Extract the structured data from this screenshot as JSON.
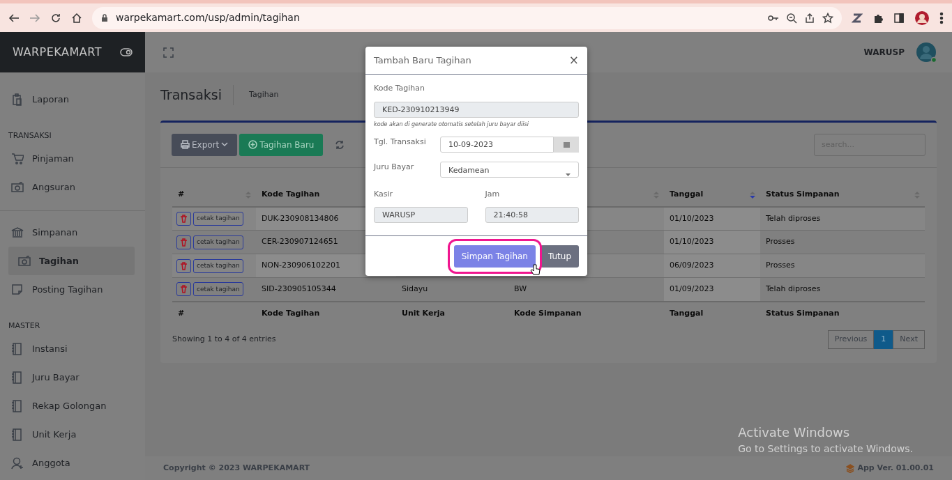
{
  "browser": {
    "url": "warpekamart.com/usp/admin/tagihan"
  },
  "brand": "WARPEKAMART",
  "user": {
    "name": "WARUSP",
    "online": true
  },
  "sidebar": {
    "items": [
      {
        "kind": "link",
        "label": "Laporan",
        "selected": false
      },
      {
        "kind": "heading",
        "label": "TRANSAKSI"
      },
      {
        "kind": "link",
        "label": "Pinjaman",
        "selected": false
      },
      {
        "kind": "link",
        "label": "Angsuran",
        "selected": false
      },
      {
        "kind": "divider"
      },
      {
        "kind": "link",
        "label": "Simpanan",
        "selected": false,
        "children": [
          {
            "kind": "link",
            "label": "Tagihan",
            "selected": true
          }
        ]
      },
      {
        "kind": "link",
        "label": "Posting Tagihan",
        "selected": false
      },
      {
        "kind": "heading",
        "label": "MASTER"
      },
      {
        "kind": "link",
        "label": "Instansi",
        "selected": false
      },
      {
        "kind": "link",
        "label": "Juru Bayar",
        "selected": false
      },
      {
        "kind": "link",
        "label": "Rekap Golongan",
        "selected": false
      },
      {
        "kind": "link",
        "label": "Unit Kerja",
        "selected": false
      },
      {
        "kind": "link",
        "label": "Anggota",
        "selected": false
      }
    ]
  },
  "page": {
    "title": "Transaksi",
    "breadcrumb": "Tagihan"
  },
  "toolbar": {
    "buttons": [
      {
        "kind": "dropdown",
        "label": "Export"
      },
      {
        "kind": "add",
        "label": "Tagihan Baru"
      }
    ],
    "search": {
      "placeholder": "search..."
    }
  },
  "table": {
    "columns": [
      {
        "label": "#",
        "sorted": false
      },
      {
        "label": "Kode Tagihan"
      },
      {},
      {
        "sorted": false
      },
      {
        "label": "Tanggal",
        "sorted": true
      },
      {
        "label": "Status Simpanan",
        "sorted": false
      }
    ],
    "rows": [
      {
        "action": "cetak tagihan",
        "kode_tagihan": "DUK-230908134806",
        "tanggal": "01/10/2023",
        "status": "Telah diproses"
      },
      {
        "action": "cetak tagihan",
        "kode_tagihan": "CER-230907124651",
        "tanggal": "01/10/2023",
        "status": "Prosses"
      },
      {
        "action": "cetak tagihan",
        "kode_tagihan": "NON-230906102201",
        "tanggal": "06/09/2023",
        "status": "Prosses"
      },
      {
        "action": "cetak tagihan",
        "kode_tagihan": "SID-230905105344",
        "unit_kerja": "Sidayu",
        "kode_simpanan": "BW",
        "tanggal": "01/09/2023",
        "status": "Telah diproses"
      }
    ],
    "footer_columns": [
      "#",
      "Kode Tagihan",
      "Unit Kerja",
      "Kode Simpanan",
      "Tanggal",
      "Status Simpanan"
    ],
    "info": "Showing 1 to 4 of 4 entries",
    "pagination": [
      {
        "label": "Previous",
        "selected": false
      },
      {
        "label": "1",
        "selected": true
      },
      {
        "label": "Next",
        "selected": false
      }
    ]
  },
  "footer": {
    "copyright": "Copyright © 2023 WARPEKAMART",
    "version": "App Ver. 01.00.01"
  },
  "modal": {
    "title": "Tambah Baru Tagihan",
    "close": "×",
    "kode_tagihan": {
      "label": "Kode Tagihan",
      "value": "KED-230910213949",
      "help": "kode akan di generate otomatis setelah juru bayar diisi"
    },
    "tgl_transaksi": {
      "label": "Tgl. Transaksi",
      "value": "10-09-2023"
    },
    "juru_bayar": {
      "label": "Juru Bayar",
      "value": "Kedamean"
    },
    "kasir": {
      "label": "Kasir",
      "value": "WARUSP"
    },
    "jam": {
      "label": "Jam",
      "value": "21:40:58"
    },
    "buttons": [
      {
        "kind": "primary",
        "label": "Simpan Tagihan",
        "highlighted": true
      },
      {
        "kind": "secondary",
        "label": "Tutup",
        "highlighted": false
      }
    ]
  },
  "os_notice": {
    "title": "Activate Windows",
    "text": "Go to Settings to activate Windows."
  }
}
